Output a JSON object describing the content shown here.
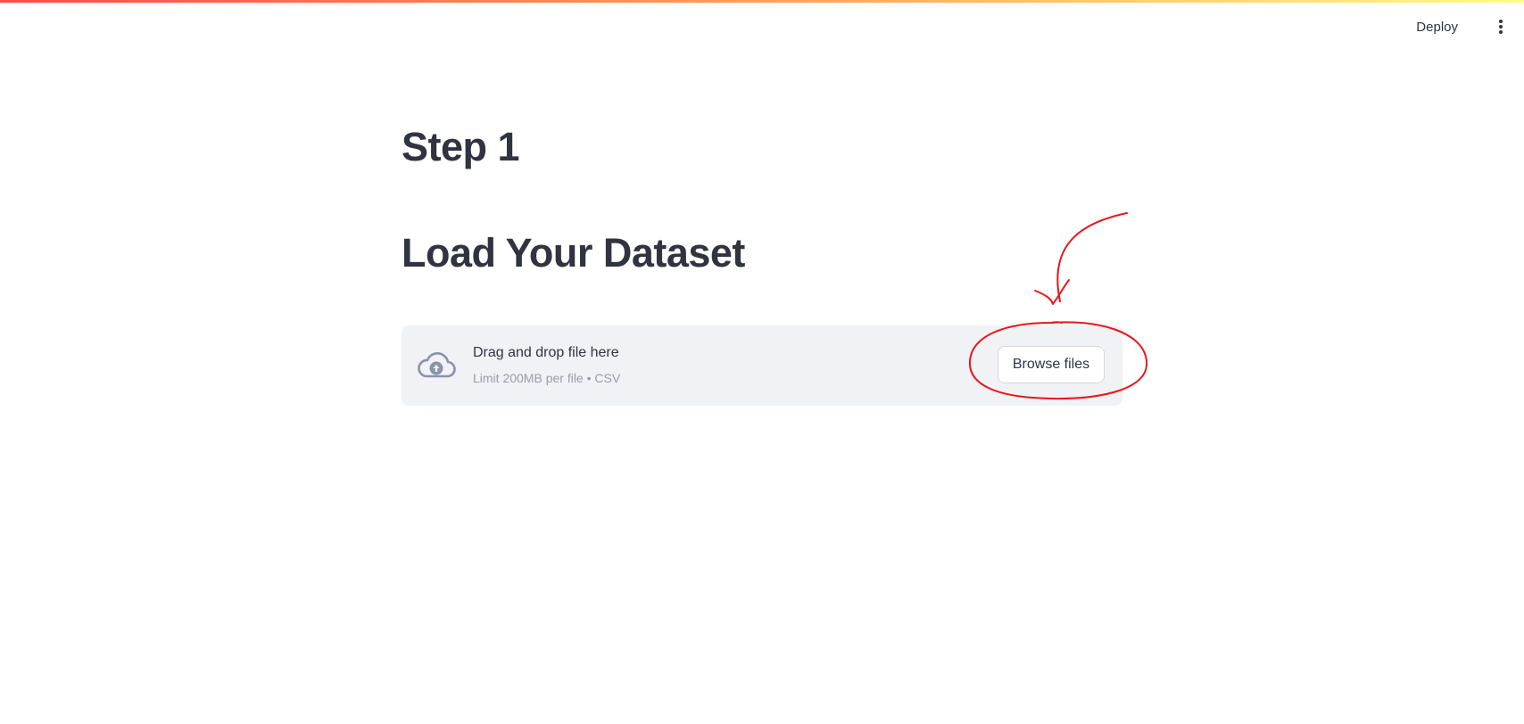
{
  "header": {
    "deploy_label": "Deploy",
    "menu_icon": "vertical-ellipsis-icon"
  },
  "main": {
    "heading_step": "Step 1",
    "heading_load": "Load Your Dataset"
  },
  "uploader": {
    "icon": "cloud-upload-icon",
    "title": "Drag and drop file here",
    "subtitle": "Limit 200MB per file • CSV",
    "browse_label": "Browse files"
  },
  "colors": {
    "text": "#31333f",
    "dropzone_bg": "#f0f2f6",
    "subtext": "#9a9ca6",
    "annotation": "#e8161b",
    "accent_gradient": [
      "#ff4b4b",
      "#ff9f5a",
      "#fffd80"
    ]
  }
}
